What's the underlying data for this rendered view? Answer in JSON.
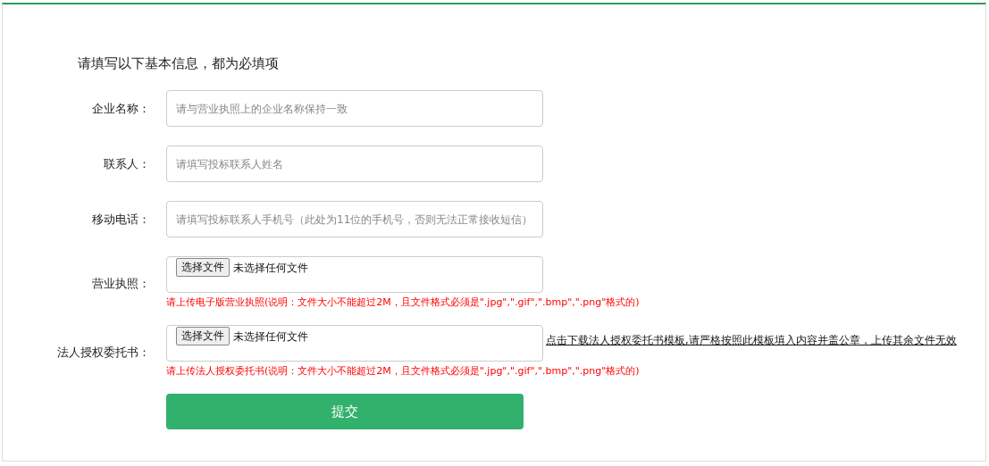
{
  "heading": "请填写以下基本信息，都为必填项",
  "fields": [
    {
      "kind": "text",
      "label": "企业名称：",
      "placeholder": "请与营业执照上的企业名称保持一致"
    },
    {
      "kind": "text",
      "label": "联系人：",
      "placeholder": "请填写投标联系人姓名"
    },
    {
      "kind": "text",
      "label": "移动电话：",
      "placeholder": "请填写投标联系人手机号（此处为11位的手机号，否则无法正常接收短信）"
    },
    {
      "kind": "file",
      "label": "营业执照：",
      "button": "选择文件",
      "status": "未选择任何文件",
      "hint": "请上传电子版营业执照(说明：文件大小不能超过2M，且文件格式必须是\".jpg\",\".gif\",\".bmp\",\".png\"格式的)"
    },
    {
      "kind": "file",
      "label": "法人授权委托书：",
      "button": "选择文件",
      "status": "未选择任何文件",
      "link": "点击下载法人授权委托书模板,请严格按照此模板填入内容并盖公章，上传其余文件无效",
      "hint": "请上传法人授权委托书(说明：文件大小不能超过2M，且文件格式必须是\".jpg\",\".gif\",\".bmp\",\".png\"格式的)"
    }
  ],
  "submit": "提交"
}
